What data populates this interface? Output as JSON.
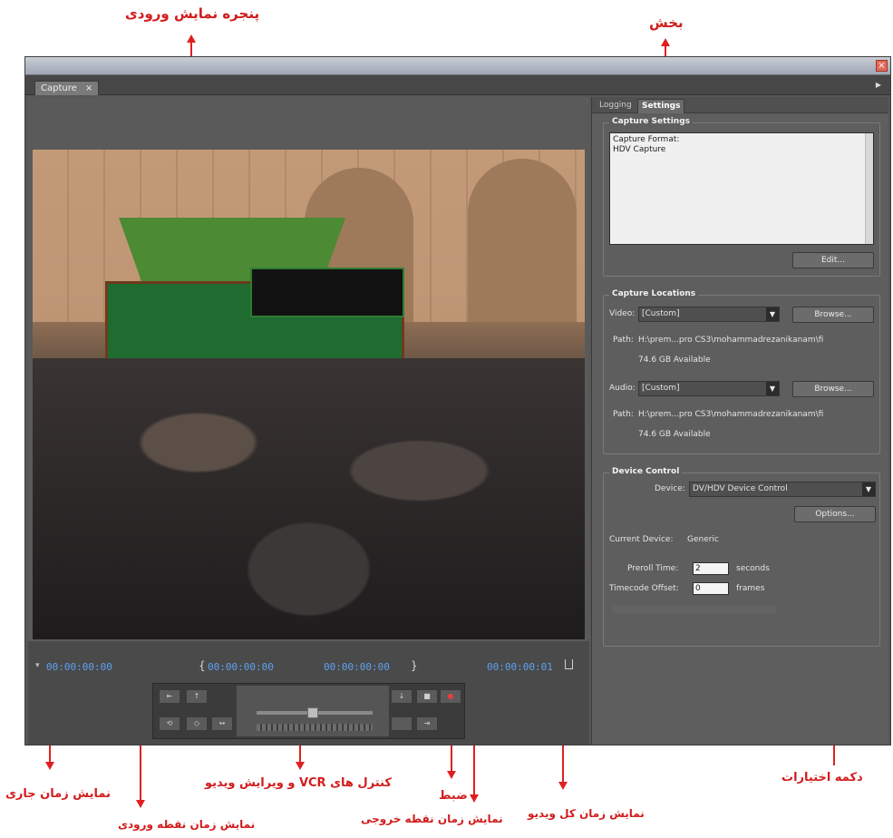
{
  "annotations": {
    "preview_window": "پنجره نمایش ورودی",
    "section": "بخش",
    "options_button": "دکمه اختیارات",
    "current_time": "نمایش زمان جاری",
    "in_point_time": "نمایش زمان نقطه ورودی",
    "vcr_controls": "کنترل های VCR و ویرایش ویدیو",
    "record": "ضبط",
    "out_point_time": "نمایش زمان نقطه خروجی",
    "total_duration": "نمایش زمان کل ویدیو"
  },
  "window": {
    "close_glyph": "×",
    "tab_label": "Capture",
    "tab_glyph": "×",
    "panel_menu_glyph": "▶"
  },
  "timecodes": {
    "current": "00:00:00:00",
    "in_point": "00:00:00:00",
    "out_point": "00:00:00:00",
    "duration": "00:00:00:01",
    "current_marker": "▾",
    "in_bracket": "{",
    "out_bracket": "}"
  },
  "transport": {
    "row1": [
      "⇤",
      "↑",
      "◀◀",
      "◀|",
      "▶",
      "|▶",
      "▶▶",
      "↓",
      "■",
      "●"
    ],
    "row2": [
      "⟲",
      "◇",
      "↔",
      "",
      "⇥"
    ]
  },
  "subtabs": {
    "logging": "Logging",
    "settings": "Settings"
  },
  "capture_settings": {
    "title": "Capture Settings",
    "format_lines": [
      "Capture Format:",
      "HDV Capture"
    ],
    "edit_button": "Edit..."
  },
  "capture_locations": {
    "title": "Capture Locations",
    "video_label": "Video:",
    "video_value": "[Custom]",
    "audio_label": "Audio:",
    "audio_value": "[Custom]",
    "browse_label": "Browse...",
    "path_label": "Path:",
    "video_path": "H:\\prem...pro CS3\\mohammadrezanikanam\\fi",
    "video_available": "74.6 GB Available",
    "audio_path": "H:\\prem...pro CS3\\mohammadrezanikanam\\fi",
    "audio_available": "74.6 GB Available"
  },
  "device_control": {
    "title": "Device Control",
    "device_label": "Device:",
    "device_value": "DV/HDV Device Control",
    "options_button": "Options...",
    "current_device_label": "Current Device:",
    "current_device_value": "Generic",
    "preroll_label": "Preroll Time:",
    "preroll_value": "2",
    "preroll_unit": "seconds",
    "timecode_label": "Timecode Offset:",
    "timecode_value": "0",
    "timecode_unit": "frames"
  },
  "colors": {
    "annotation": "#d21c1c",
    "timecode": "#5da0f0",
    "panel_bg": "#5e5e5e"
  }
}
